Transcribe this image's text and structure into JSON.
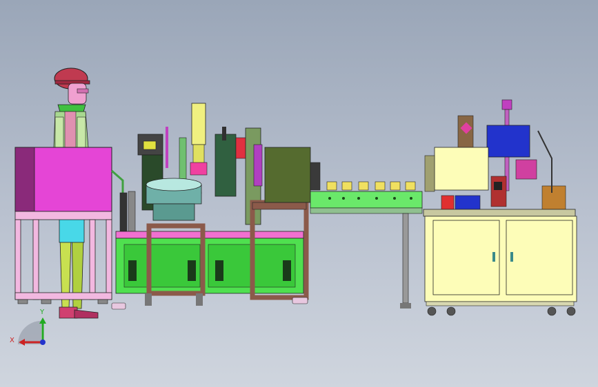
{
  "scene": {
    "kind": "cad-assembly-view",
    "background_top": "#9aa6b8",
    "background_bottom": "#cfd5de"
  },
  "triad": {
    "x_label": "X",
    "y_label": "Y",
    "x_color": "#cc2222",
    "y_color": "#22aa22",
    "z_color": "#2233cc"
  },
  "colors": {
    "magenta_box": "#e545d6",
    "frame_pink": "#f2b8e0",
    "machine_green": "#4fe04f",
    "olive_panel": "#556b2f",
    "cabinet_yellow": "#fdfdb8",
    "frame_brown": "#8b5a4a",
    "steel_teal": "#8fcfc8",
    "blue_box": "#2233cc"
  },
  "icons": {
    "triad": "coordinate-triad-icon",
    "human": "operator-figure-icon"
  }
}
